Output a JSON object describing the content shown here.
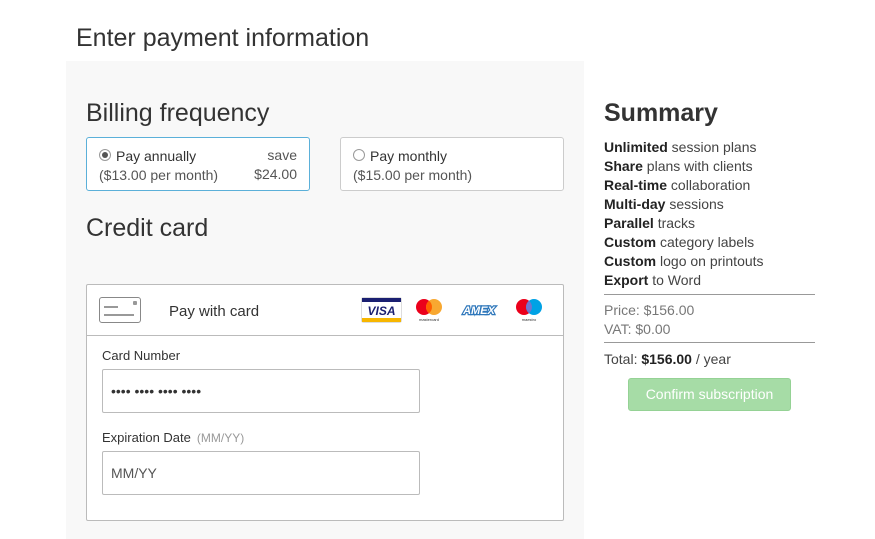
{
  "page": {
    "title": "Enter payment information"
  },
  "billing": {
    "title": "Billing frequency",
    "options": [
      {
        "label": "Pay annually",
        "sub": "($13.00 per month)",
        "save_label": "save",
        "save_amount": "$24.00",
        "selected": true
      },
      {
        "label": "Pay monthly",
        "sub": "($15.00 per month)",
        "selected": false
      }
    ]
  },
  "credit_card": {
    "title": "Credit card",
    "pay_with_card": "Pay with card",
    "brands": [
      "VISA",
      "mastercard",
      "AMEX",
      "maestro"
    ],
    "card_number": {
      "label": "Card Number",
      "value": "•••• •••• •••• ••••"
    },
    "expiration": {
      "label": "Expiration Date",
      "hint": "(MM/YY)",
      "placeholder": "MM/YY"
    }
  },
  "summary": {
    "title": "Summary",
    "features": [
      {
        "bold": "Unlimited",
        "rest": " session plans"
      },
      {
        "bold": "Share",
        "rest": " plans with clients"
      },
      {
        "bold": "Real-time",
        "rest": " collaboration"
      },
      {
        "bold": "Multi-day",
        "rest": " sessions"
      },
      {
        "bold": "Parallel",
        "rest": " tracks"
      },
      {
        "bold": "Custom",
        "rest": " category labels"
      },
      {
        "bold": "Custom",
        "rest": " logo on printouts"
      },
      {
        "bold": "Export",
        "rest": " to Word"
      }
    ],
    "price": "Price: $156.00",
    "vat": "VAT: $0.00",
    "total_label": "Total: ",
    "total_value": "$156.00",
    "total_suffix": " / year",
    "confirm_label": "Confirm subscription"
  },
  "colors": {
    "selected_border": "#5bb0d9",
    "confirm_bg": "#a6dca6",
    "panel_bg": "#f8f8f8"
  }
}
